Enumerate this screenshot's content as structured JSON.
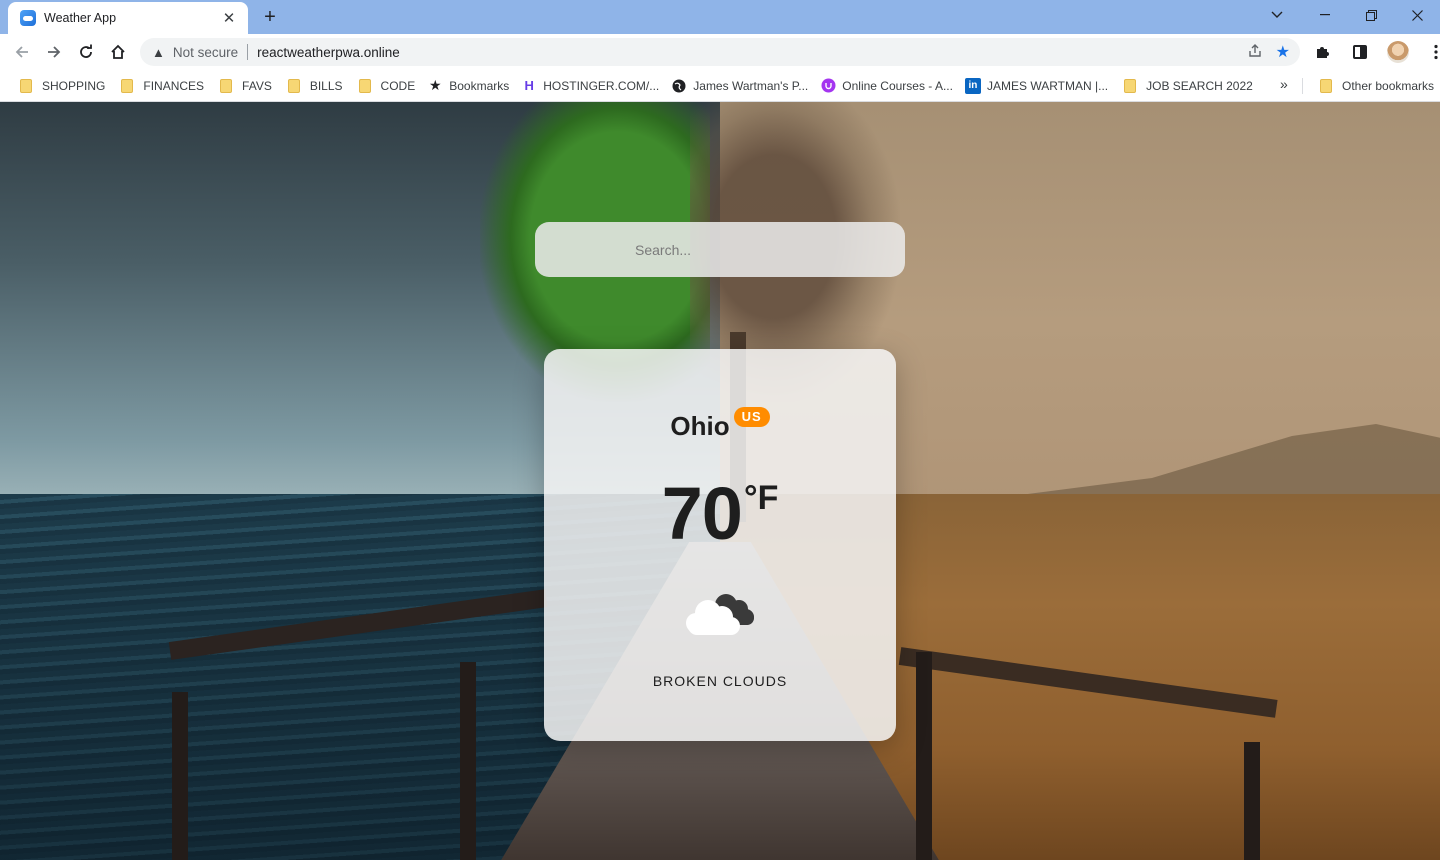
{
  "browser": {
    "tab_title": "Weather App",
    "new_tab": "+",
    "tab_close": "✕",
    "not_secure": "Not secure",
    "url": "reactweatherpwa.online",
    "bookmarks": [
      {
        "label": "SHOPPING",
        "icon": "folder-icon"
      },
      {
        "label": "FINANCES",
        "icon": "folder-icon"
      },
      {
        "label": "FAVS",
        "icon": "folder-icon"
      },
      {
        "label": "BILLS",
        "icon": "folder-icon"
      },
      {
        "label": "CODE",
        "icon": "folder-icon"
      },
      {
        "label": "Bookmarks",
        "icon": "star-icon"
      },
      {
        "label": "HOSTINGER.COM/...",
        "icon": "hostinger-icon"
      },
      {
        "label": "James Wartman's P...",
        "icon": "globe-icon"
      },
      {
        "label": "Online Courses - A...",
        "icon": "udemy-icon"
      },
      {
        "label": "JAMES WARTMAN |...",
        "icon": "linkedin-icon"
      },
      {
        "label": "JOB SEARCH 2022",
        "icon": "folder-icon"
      }
    ],
    "more_bookmarks": "»",
    "other_bookmarks": "Other bookmarks"
  },
  "app": {
    "search_placeholder": "Search...",
    "city": "Ohio",
    "country": "US",
    "temperature": "70",
    "unit": "°F",
    "description": "BROKEN CLOUDS",
    "icon": "broken-clouds-icon",
    "accent": "#ff8c00"
  }
}
